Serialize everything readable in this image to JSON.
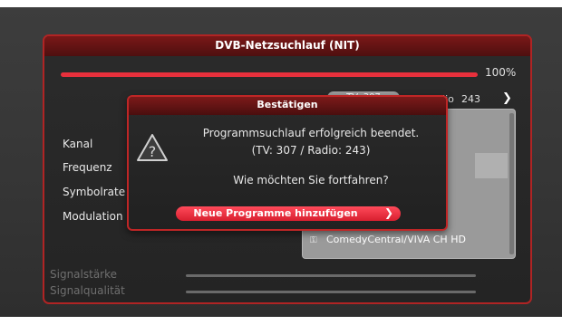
{
  "window": {
    "title": "DVB-Netzsuchlauf (NIT)",
    "progress_fraction": 1.0,
    "progress_percent": "100%"
  },
  "tabs": {
    "tv_label": "TV: 307",
    "radio_label": "Radio",
    "radio_count": "243"
  },
  "channel_list": {
    "visible_item": "ComedyCentral/VIVA CH HD"
  },
  "labels": {
    "kanal": "Kanal",
    "frequenz": "Frequenz",
    "symbolrate": "Symbolrate",
    "modulation": "Modulation",
    "signal_strength": "Signalstärke",
    "signal_quality": "Signalqualität"
  },
  "dialog": {
    "title": "Bestätigen",
    "message_line1": "Programmsuchlauf erfolgreich beendet.",
    "message_line2": "(TV: 307 / Radio: 243)",
    "question": "Wie möchten Sie fortfahren?",
    "action_label": "Neue Programme hinzufügen",
    "icon": "warning-icon"
  },
  "colors": {
    "accent": "#e8303c",
    "header": "#7a1818",
    "background": "#3a3a3a"
  }
}
